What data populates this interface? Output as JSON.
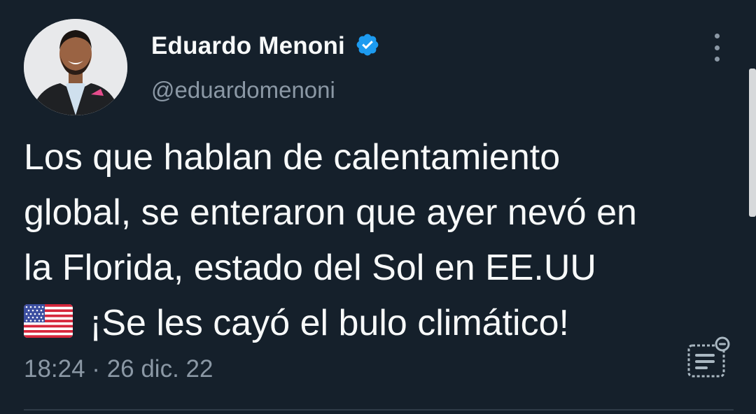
{
  "tweet": {
    "author": {
      "display_name": "Eduardo Menoni",
      "handle": "@eduardomenoni",
      "verified": true,
      "avatar": "profile-photo"
    },
    "text_lines": [
      "Los que hablan de calentamiento",
      "global, se enteraron que ayer nevó en",
      "la Florida, estado del Sol en EE.UU",
      "¡Se les cayó el bulo climático!"
    ],
    "emoji": "us-flag",
    "timestamp": "18:24 · 26 dic. 22"
  },
  "icons": {
    "more": "more-vertical-icon",
    "analytics": "tweet-analytics-icon",
    "verified": "verified-badge-icon"
  },
  "colors": {
    "background": "#15202b",
    "text_primary": "#f7f9f9",
    "text_secondary": "#8b98a5",
    "verified_blue": "#1d9bf0",
    "divider": "#2f3b47"
  }
}
